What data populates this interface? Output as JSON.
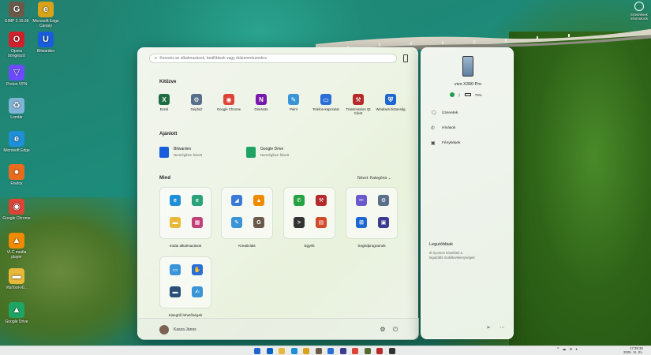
{
  "desktop": {
    "icons": [
      {
        "label": "GIMP 2.10.38",
        "icon": "gimp-icon",
        "color": "#6b5a4a",
        "glyph": "G"
      },
      {
        "label": "Microsoft Edge Canary",
        "icon": "edge-canary-icon",
        "color": "#d8a21a",
        "glyph": "e"
      },
      {
        "label": "Opera böngésző",
        "icon": "opera-icon",
        "color": "#d1202b",
        "glyph": "O"
      },
      {
        "label": "Bitwarden",
        "icon": "bitwarden-icon",
        "color": "#175ddc",
        "glyph": "U"
      },
      {
        "label": "Proton VPN",
        "icon": "protonvpn-icon",
        "color": "#6d4aff",
        "glyph": "▽"
      },
      {
        "label": "Lomtár",
        "icon": "recycle-bin-icon",
        "color": "#7fb4d6",
        "glyph": "♻"
      },
      {
        "label": "Microsoft Edge",
        "icon": "edge-icon",
        "color": "#1f8fd8",
        "glyph": "e"
      },
      {
        "label": "Firefox",
        "icon": "firefox-icon",
        "color": "#e96b1c",
        "glyph": "●"
      },
      {
        "label": "Google Chrome",
        "icon": "chrome-icon",
        "color": "#db4437",
        "glyph": "◉"
      },
      {
        "label": "VLC media player",
        "icon": "vlc-icon",
        "color": "#f08a00",
        "glyph": "▲"
      },
      {
        "label": "VtaTool-v0...",
        "icon": "folder-icon",
        "color": "#e8b83a",
        "glyph": "▬"
      },
      {
        "label": "Google Drive",
        "icon": "google-drive-icon",
        "color": "#1fa463",
        "glyph": "▲"
      }
    ],
    "notification": {
      "label": "Értesítések",
      "sublabel": "információk"
    }
  },
  "start_menu": {
    "search": {
      "placeholder": "Keresés az alkalmazások, beállítások vagy dokumentumokra"
    },
    "pinned_title": "Kitűzve",
    "pinned": [
      {
        "label": "Excel",
        "icon": "excel-icon",
        "color": "#1d6f42",
        "glyph": "X"
      },
      {
        "label": "Gépház",
        "icon": "settings-gear-icon",
        "color": "#5a6f8a",
        "glyph": "⚙"
      },
      {
        "label": "Google Chrome",
        "icon": "chrome-icon",
        "color": "#db4437",
        "glyph": "◉"
      },
      {
        "label": "OneNote",
        "icon": "onenote-icon",
        "color": "#7719aa",
        "glyph": "N"
      },
      {
        "label": "Paint",
        "icon": "paint-icon",
        "color": "#3a95d8",
        "glyph": "✎"
      },
      {
        "label": "Telefon-kapcsolat",
        "icon": "phone-link-icon",
        "color": "#2a6fd6",
        "glyph": "▭"
      },
      {
        "label": "Transmission Qt Client",
        "icon": "transmission-icon",
        "color": "#b52a2a",
        "glyph": "⚒"
      },
      {
        "label": "Windows biztonság",
        "icon": "windows-security-icon",
        "color": "#1e66d0",
        "glyph": "⛨"
      }
    ],
    "recommended_title": "Ajánlott",
    "recommended": [
      {
        "title": "Bitwarden",
        "subtitle": "Nemrégiben felvett",
        "icon": "bitwarden-icon",
        "color": "#175ddc"
      },
      {
        "title": "Google Drive",
        "subtitle": "Nemrégiben felvett",
        "icon": "google-drive-icon",
        "color": "#1fa463"
      }
    ],
    "all_title": "Mind",
    "view_toggle": "Nézet: Kategória",
    "categories": [
      {
        "label": "Irodai alkalmazások",
        "cells": [
          {
            "icon": "edge-icon",
            "color": "#1f8fd8",
            "glyph": "e"
          },
          {
            "icon": "edge-canary-icon",
            "color": "#2aa37a",
            "glyph": "e"
          },
          {
            "icon": "file-explorer-icon",
            "color": "#e8b83a",
            "glyph": "▬"
          },
          {
            "icon": "apps-icon",
            "color": "#c2407a",
            "glyph": "▦"
          }
        ]
      },
      {
        "label": "Kreativitás",
        "cells": [
          {
            "icon": "photos-icon",
            "color": "#3a7bd5",
            "glyph": "◢"
          },
          {
            "icon": "vlc-icon",
            "color": "#f08a00",
            "glyph": "▲"
          },
          {
            "icon": "paint-icon",
            "color": "#3a95d8",
            "glyph": "✎"
          },
          {
            "icon": "gimp-icon",
            "color": "#6b5a4a",
            "glyph": "G"
          }
        ]
      },
      {
        "label": "Egyéb",
        "cells": [
          {
            "icon": "whatsapp-icon",
            "color": "#25a244",
            "glyph": "✆"
          },
          {
            "icon": "transmission-icon",
            "color": "#b52a2a",
            "glyph": "⚒"
          },
          {
            "icon": "terminal-icon",
            "color": "#333333",
            "glyph": ">"
          },
          {
            "icon": "office-icon",
            "color": "#d04a2a",
            "glyph": "▤"
          }
        ]
      },
      {
        "label": "Segédprogramok",
        "cells": [
          {
            "icon": "snipping-tool-icon",
            "color": "#6a5acd",
            "glyph": "✂"
          },
          {
            "icon": "settings-gear-icon",
            "color": "#5a6f8a",
            "glyph": "⚙"
          },
          {
            "icon": "windows-icon",
            "color": "#1e66d0",
            "glyph": "⊞"
          },
          {
            "icon": "store-icon",
            "color": "#3b3b8f",
            "glyph": "▣"
          }
        ]
      },
      {
        "label": "Kisegítő lehetőségek",
        "cells": [
          {
            "icon": "display-icon",
            "color": "#3a95d8",
            "glyph": "▭"
          },
          {
            "icon": "accessibility-icon",
            "color": "#2a6fd6",
            "glyph": "✋"
          },
          {
            "icon": "monitor-icon",
            "color": "#2a4f7a",
            "glyph": "▬"
          },
          {
            "icon": "narrator-icon",
            "color": "#3a95d8",
            "glyph": "✍"
          }
        ]
      }
    ],
    "user": {
      "name": "Kasza János"
    }
  },
  "phone_panel": {
    "device_name": "vivo X300 Pro",
    "battery": "79%",
    "items": [
      {
        "label": "Üzenetek",
        "icon": "messages-icon"
      },
      {
        "label": "Hívások",
        "icon": "calls-icon"
      },
      {
        "label": "Fényképek",
        "icon": "photos-icon"
      }
    ],
    "recent_title": "Legutóbbiak",
    "recent_desc": "Itt nyomon követheti a legutóbbi mobiltevékenységeit"
  },
  "taskbar": {
    "time": "17:39:38",
    "date": "2025. 11. 01.",
    "icons": [
      {
        "icon": "windows-start-icon",
        "color": "#1e66d0"
      },
      {
        "icon": "outlook-icon",
        "color": "#0a62c4"
      },
      {
        "icon": "file-explorer-icon",
        "color": "#e8b83a"
      },
      {
        "icon": "edge-icon",
        "color": "#1f8fd8"
      },
      {
        "icon": "edge-canary-icon",
        "color": "#d8a21a"
      },
      {
        "icon": "gimp-icon",
        "color": "#6b5a4a"
      },
      {
        "icon": "phone-link-icon",
        "color": "#2a6fd6"
      },
      {
        "icon": "store-icon",
        "color": "#3b3b8f"
      },
      {
        "icon": "chrome-icon",
        "color": "#db4437"
      },
      {
        "icon": "app-icon",
        "color": "#556b2f"
      },
      {
        "icon": "transmission-icon",
        "color": "#b52a2a"
      },
      {
        "icon": "terminal-icon",
        "color": "#333333"
      }
    ]
  }
}
